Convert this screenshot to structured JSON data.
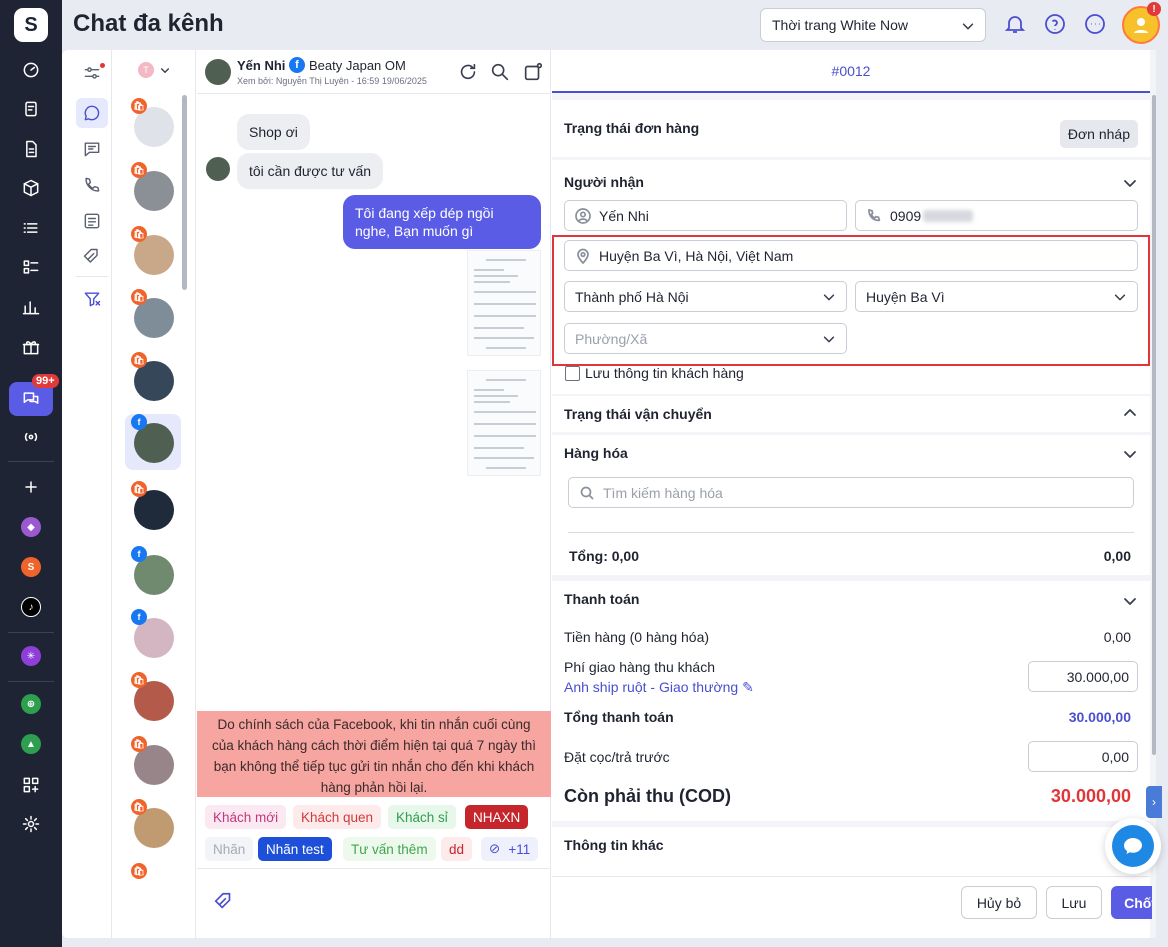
{
  "app": {
    "title": "Chat đa kênh",
    "logo": "S"
  },
  "topbar": {
    "store_name": "Thời trang White Now",
    "avatar_badge": "!"
  },
  "rail": {
    "chat_badge": "99+"
  },
  "conversation": {
    "customer_name": "Yến Nhi",
    "page_name": "Beaty Japan OM",
    "viewed_by": "Xem bởi: Nguyễn Thị Luyên - 16:59 19/06/2025",
    "filter_initial": "T",
    "messages": [
      {
        "dir": "in",
        "text": "Shop ơi"
      },
      {
        "dir": "in",
        "text": "tôi cần được tư vấn"
      },
      {
        "dir": "out",
        "text": "Tôi đang xếp dép ngồi nghe, Bạn muốn gì"
      }
    ],
    "fb_notice": "Do chính sách của Facebook, khi tin nhắn cuối cùng của khách hàng cách thời điểm hiện tại quá 7 ngày thì bạn không thể tiếp tục gửi tin nhắn cho đến khi khách hàng phản hồi lại.",
    "tags": [
      "Khách mới",
      "Khách quen",
      "Khách sỉ",
      "NHAXN",
      "Nhãn",
      "Nhãn test",
      "Tư vấn thêm",
      "dd",
      "+11"
    ]
  },
  "order": {
    "id": "#0012",
    "status_label": "Trạng thái đơn hàng",
    "status_value": "Đơn nháp",
    "recipient_title": "Người nhận",
    "recipient_name": "Yến Nhi",
    "recipient_phone": "0909",
    "address": "Huyện Ba Vì, Hà Nội, Việt Nam",
    "city": "Thành phố Hà Nội",
    "district": "Huyện Ba Vì",
    "ward_placeholder": "Phường/Xã",
    "save_customer": "Lưu thông tin khách hàng",
    "shipping_title": "Trạng thái vận chuyển",
    "goods_title": "Hàng hóa",
    "goods_search_placeholder": "Tìm kiếm hàng hóa",
    "total_label": "Tổng: 0,00",
    "total_value": "0,00",
    "payment_title": "Thanh toán",
    "subtotal_label": "Tiền hàng (0 hàng hóa)",
    "subtotal_value": "0,00",
    "shipping_fee_label": "Phí giao hàng thu khách",
    "shipping_fee_value": "30.000,00",
    "shipper": "Anh ship ruột",
    "ship_method": "Giao thường",
    "grand_total_label": "Tổng thanh toán",
    "grand_total_value": "30.000,00",
    "deposit_label": "Đặt cọc/trả trước",
    "deposit_value": "0,00",
    "cod_label": "Còn phải thu (COD)",
    "cod_value": "30.000,00",
    "other_title": "Thông tin khác",
    "btn_cancel": "Hủy bỏ",
    "btn_save": "Lưu",
    "btn_submit": "Chốt đơn"
  },
  "colors": {
    "accent": "#5b5ce6",
    "danger": "#e0363a",
    "notice": "#f6a5a0"
  }
}
